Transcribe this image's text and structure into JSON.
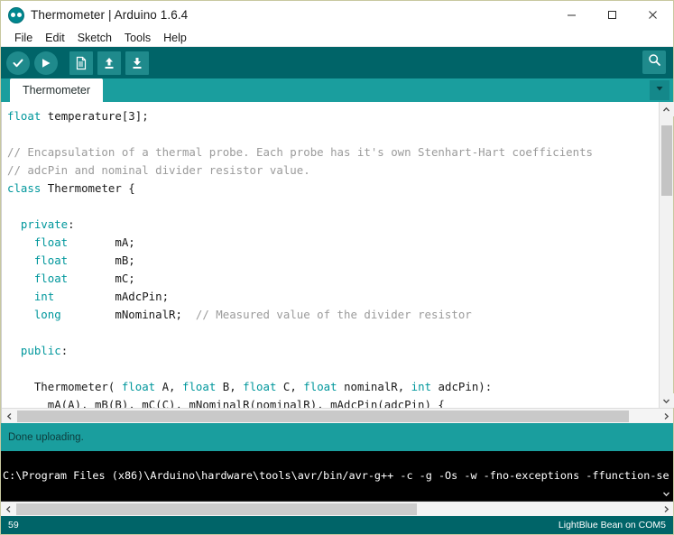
{
  "window": {
    "title": "Thermometer | Arduino 1.6.4",
    "logo_icon": "arduino-logo-icon",
    "minimize_label": "Minimize",
    "maximize_label": "Maximize",
    "close_label": "Close"
  },
  "menubar": {
    "items": [
      {
        "label": "File"
      },
      {
        "label": "Edit"
      },
      {
        "label": "Sketch"
      },
      {
        "label": "Tools"
      },
      {
        "label": "Help"
      }
    ]
  },
  "toolbar": {
    "buttons": [
      {
        "name": "verify-button",
        "icon": "checkmark-icon",
        "label": "Verify"
      },
      {
        "name": "upload-button",
        "icon": "arrow-right-icon",
        "label": "Upload"
      },
      {
        "name": "new-button",
        "icon": "new-document-icon",
        "label": "New"
      },
      {
        "name": "open-button",
        "icon": "arrow-up-icon",
        "label": "Open"
      },
      {
        "name": "save-button",
        "icon": "arrow-down-icon",
        "label": "Save"
      }
    ],
    "serial_monitor": {
      "icon": "magnifier-icon",
      "label": "Serial Monitor"
    }
  },
  "tabs": {
    "active": "Thermometer",
    "items": [
      {
        "label": "Thermometer"
      }
    ],
    "dropdown_icon": "chevron-down-icon"
  },
  "editor": {
    "lines": [
      {
        "segments": [
          {
            "t": "float",
            "c": "kw"
          },
          {
            "t": " temperature[3];",
            "c": "lit"
          }
        ]
      },
      {
        "segments": [
          {
            "t": "",
            "c": "lit"
          }
        ]
      },
      {
        "segments": [
          {
            "t": "// Encapsulation of a thermal probe. Each probe has it's own Stenhart-Hart coefficients",
            "c": "cmt"
          }
        ]
      },
      {
        "segments": [
          {
            "t": "// adcPin and nominal divider resistor value.",
            "c": "cmt"
          }
        ]
      },
      {
        "segments": [
          {
            "t": "class",
            "c": "kw"
          },
          {
            "t": " Thermometer {",
            "c": "lit"
          }
        ]
      },
      {
        "segments": [
          {
            "t": "",
            "c": "lit"
          }
        ]
      },
      {
        "segments": [
          {
            "t": "  ",
            "c": "lit"
          },
          {
            "t": "private",
            "c": "kw"
          },
          {
            "t": ":",
            "c": "lit"
          }
        ]
      },
      {
        "segments": [
          {
            "t": "    ",
            "c": "lit"
          },
          {
            "t": "float",
            "c": "kw"
          },
          {
            "t": "       mA;",
            "c": "lit"
          }
        ]
      },
      {
        "segments": [
          {
            "t": "    ",
            "c": "lit"
          },
          {
            "t": "float",
            "c": "kw"
          },
          {
            "t": "       mB;",
            "c": "lit"
          }
        ]
      },
      {
        "segments": [
          {
            "t": "    ",
            "c": "lit"
          },
          {
            "t": "float",
            "c": "kw"
          },
          {
            "t": "       mC;",
            "c": "lit"
          }
        ]
      },
      {
        "segments": [
          {
            "t": "    ",
            "c": "lit"
          },
          {
            "t": "int",
            "c": "kw"
          },
          {
            "t": "         mAdcPin;",
            "c": "lit"
          }
        ]
      },
      {
        "segments": [
          {
            "t": "    ",
            "c": "lit"
          },
          {
            "t": "long",
            "c": "kw"
          },
          {
            "t": "        mNominalR;  ",
            "c": "lit"
          },
          {
            "t": "// Measured value of the divider resistor",
            "c": "cmt"
          }
        ]
      },
      {
        "segments": [
          {
            "t": "",
            "c": "lit"
          }
        ]
      },
      {
        "segments": [
          {
            "t": "  ",
            "c": "lit"
          },
          {
            "t": "public",
            "c": "kw"
          },
          {
            "t": ":",
            "c": "lit"
          }
        ]
      },
      {
        "segments": [
          {
            "t": "",
            "c": "lit"
          }
        ]
      },
      {
        "segments": [
          {
            "t": "    Thermometer( ",
            "c": "lit"
          },
          {
            "t": "float",
            "c": "kw"
          },
          {
            "t": " A, ",
            "c": "lit"
          },
          {
            "t": "float",
            "c": "kw"
          },
          {
            "t": " B, ",
            "c": "lit"
          },
          {
            "t": "float",
            "c": "kw"
          },
          {
            "t": " C, ",
            "c": "lit"
          },
          {
            "t": "float",
            "c": "kw"
          },
          {
            "t": " nominalR, ",
            "c": "lit"
          },
          {
            "t": "int",
            "c": "kw"
          },
          {
            "t": " adcPin):",
            "c": "lit"
          }
        ]
      },
      {
        "segments": [
          {
            "t": "      mA(A), mB(B), mC(C), mNominalR(nominalR), mAdcPin(adcPin) {",
            "c": "lit"
          }
        ]
      }
    ],
    "vscroll": {
      "up_icon": "chevron-up-icon",
      "down_icon": "chevron-down-icon"
    },
    "hscroll": {
      "left_icon": "chevron-left-icon",
      "right_icon": "chevron-right-icon"
    }
  },
  "status_message": {
    "text": "Done uploading."
  },
  "console": {
    "lines": [
      "C:\\Program Files (x86)\\Arduino\\hardware\\tools\\avr/bin/avr-g++ -c -g -Os -w -fno-exceptions -ffunction-se"
    ],
    "scroll_down_icon": "chevron-down-icon",
    "hscroll": {
      "left_icon": "chevron-left-icon",
      "right_icon": "chevron-right-icon"
    }
  },
  "statusbar": {
    "line_number": "59",
    "board_info": "LightBlue Bean on COM5"
  },
  "colors": {
    "toolbar_bg": "#006468",
    "tabstrip_bg": "#1a9e9e",
    "status_bg": "#1a9e9e",
    "keyword": "#00979c",
    "comment": "#9b9b9b",
    "console_bg": "#000000"
  }
}
